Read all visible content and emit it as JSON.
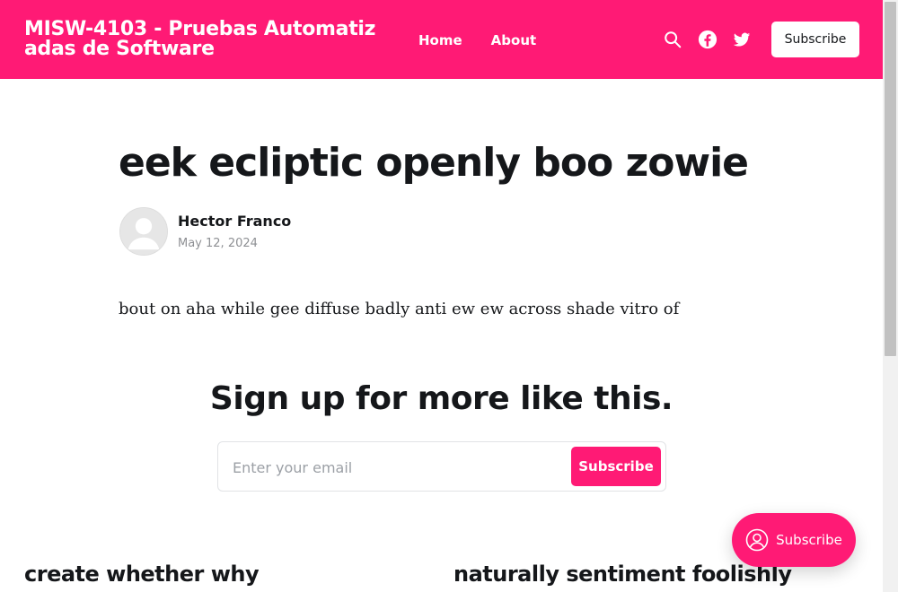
{
  "header": {
    "site_title": "MISW-4103 - Pruebas Automatizadas de Software",
    "nav": [
      {
        "label": "Home"
      },
      {
        "label": "About"
      }
    ],
    "icons": [
      "search-icon",
      "facebook-icon",
      "twitter-icon"
    ],
    "subscribe_label": "Subscribe"
  },
  "post": {
    "title": "eek ecliptic openly boo zowie",
    "author": "Hector Franco",
    "date": "May 12, 2024",
    "body": "bout on aha while gee diffuse badly anti ew ew across shade vitro of"
  },
  "cta": {
    "title": "Sign up for more like this.",
    "email_placeholder": "Enter your email",
    "email_value": "",
    "button_label": "Subscribe"
  },
  "related": [
    {
      "title": "create whether why"
    },
    {
      "title": "naturally sentiment foolishly"
    }
  ],
  "portal": {
    "label": "Subscribe"
  },
  "colors": {
    "accent": "#ff1a75",
    "text": "#15171a",
    "muted": "#8e9094"
  }
}
